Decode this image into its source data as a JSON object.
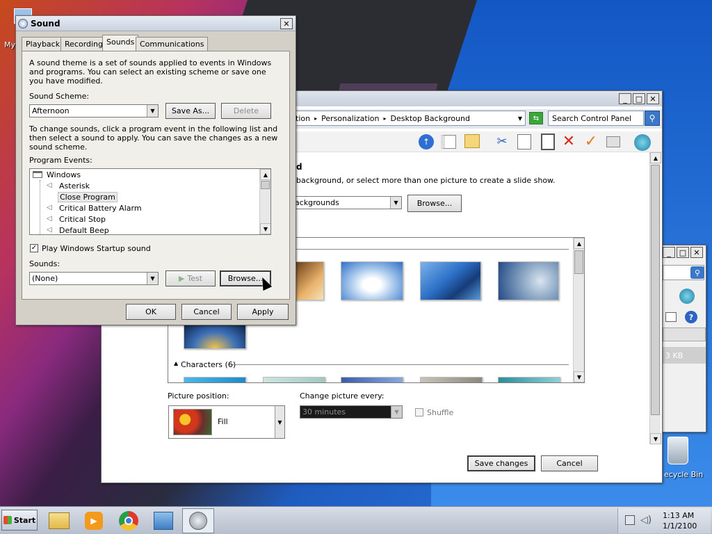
{
  "desktop": {
    "my_computer_label": "My",
    "recycle_bin_label": "ecycle Bin"
  },
  "sound_dialog": {
    "title": "Sound",
    "tabs": [
      {
        "label": "Playback"
      },
      {
        "label": "Recording"
      },
      {
        "label": "Sounds"
      },
      {
        "label": "Communications"
      }
    ],
    "description": "A sound theme is a set of sounds applied to events in Windows and programs.  You can select an existing scheme or save one you have modified.",
    "scheme_label": "Sound Scheme:",
    "scheme_value": "Afternoon",
    "save_as_label": "Save As...",
    "delete_label": "Delete",
    "instructions": "To change sounds, click a program event in the following list and then select a sound to apply.  You can save the changes as a new sound scheme.",
    "program_events_label": "Program Events:",
    "events": {
      "root": "Windows",
      "items": [
        "Asterisk",
        "Close Program",
        "Critical Battery Alarm",
        "Critical Stop",
        "Default Beep"
      ]
    },
    "startup_checkbox_label": "Play Windows Startup sound",
    "sounds_label": "Sounds:",
    "sounds_value": "(None)",
    "test_label": "Test",
    "browse_label": "Browse...",
    "ok_label": "OK",
    "cancel_label": "Cancel",
    "apply_label": "Apply"
  },
  "cp_window": {
    "breadcrumb": [
      "tion",
      "Personalization",
      "Desktop Background"
    ],
    "search_placeholder": "Search Control Panel",
    "heading_partial": "d",
    "intro": "background, or select more than one picture to create a slide show.",
    "location_value": "ackgrounds",
    "browse_label": "Browse...",
    "category_characters": "Characters (6)",
    "picture_position_label": "Picture position:",
    "picture_position_value": "Fill",
    "change_every_label": "Change picture every:",
    "change_every_value": "30 minutes",
    "shuffle_label": "Shuffle",
    "save_changes_label": "Save changes",
    "cancel_label": "Cancel"
  },
  "right_window": {
    "size_text": "3 KB"
  },
  "taskbar": {
    "start_label": "Start",
    "time": "1:13 AM",
    "date": "1/1/2100"
  },
  "colors": {
    "accent": "#3a77c8",
    "dialog_bg": "#d4d0c8",
    "selection": "#e8e8e8"
  }
}
